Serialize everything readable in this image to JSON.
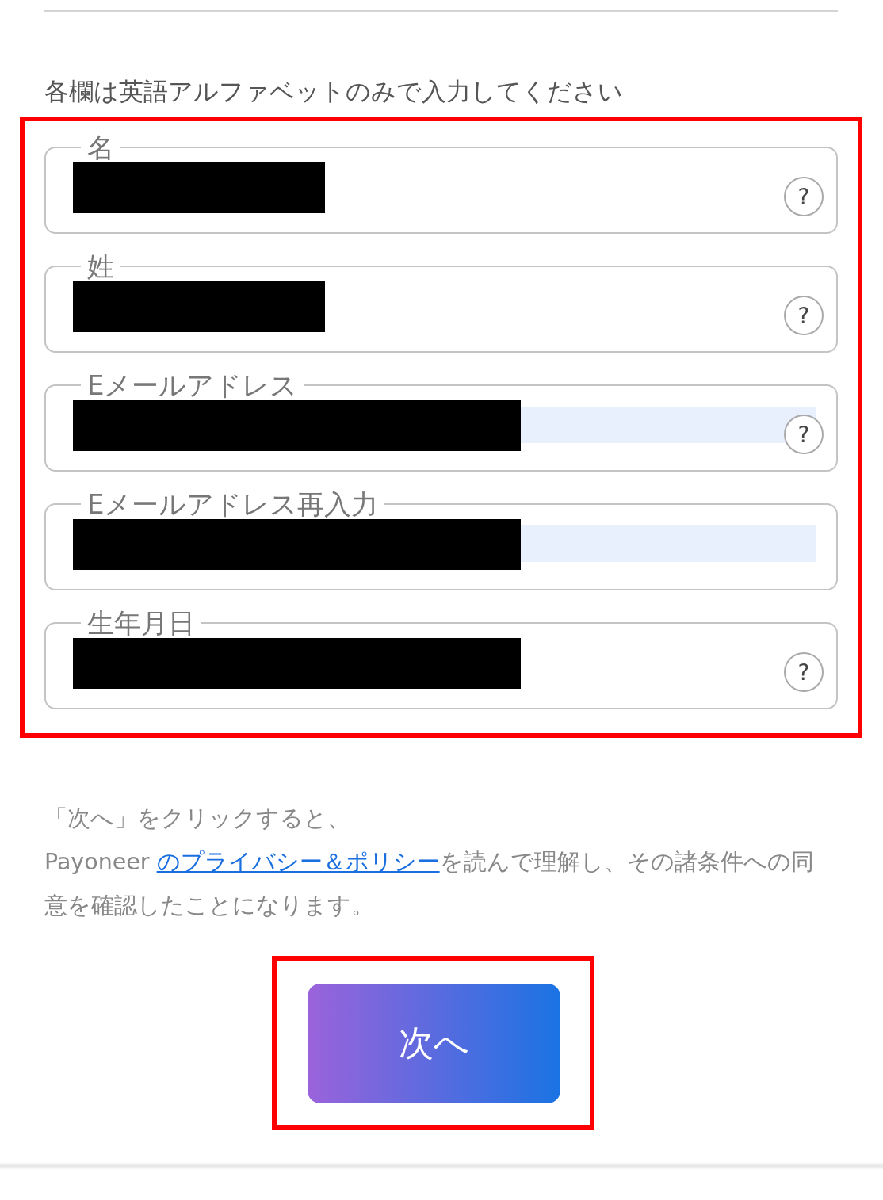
{
  "instruction": "各欄は英語アルファベットのみで入力してください",
  "form": {
    "highlighted": true,
    "fields": [
      {
        "label": "名",
        "kind": "name",
        "autofilled": false,
        "help": "?"
      },
      {
        "label": "姓",
        "kind": "name",
        "autofilled": false,
        "help": "?"
      },
      {
        "label": "Eメールアドレス",
        "kind": "email",
        "autofilled": true,
        "help": "?"
      },
      {
        "label": "Eメールアドレス再入力",
        "kind": "email",
        "autofilled": true
      },
      {
        "label": "生年月日",
        "kind": "date",
        "autofilled": false,
        "help": "?"
      }
    ]
  },
  "consent": {
    "line1": "「次へ」をクリックすると、",
    "before": "Payoneer ",
    "link": "のプライバシー＆ポリシー",
    "after": "を読んで理解し、その諸条件への同意を確認したことになります。"
  },
  "next_button": {
    "label": "次へ",
    "highlighted": true
  }
}
